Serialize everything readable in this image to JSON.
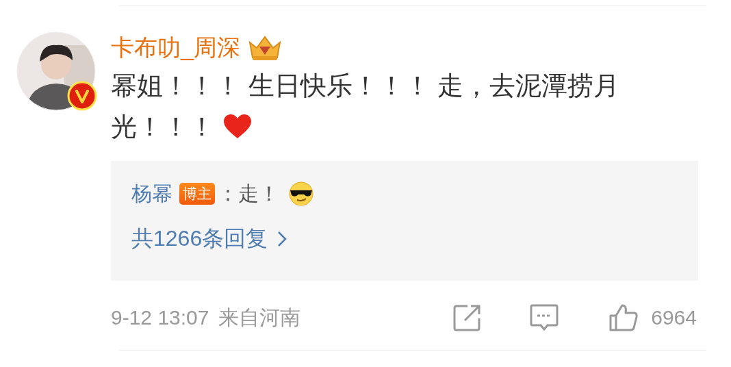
{
  "comment": {
    "author": "卡布叻_周深",
    "verified": true,
    "text_lines": [
      "幂姐！！！ 生日快乐！！！ 走，去泥潭捞月",
      "光！！！"
    ],
    "reply": {
      "author": "杨幂",
      "badge": "博主",
      "text": "：走！"
    },
    "replies_link": "共1266条回复",
    "time": "9-12 13:07",
    "source": "来自河南",
    "likes": "6964"
  }
}
